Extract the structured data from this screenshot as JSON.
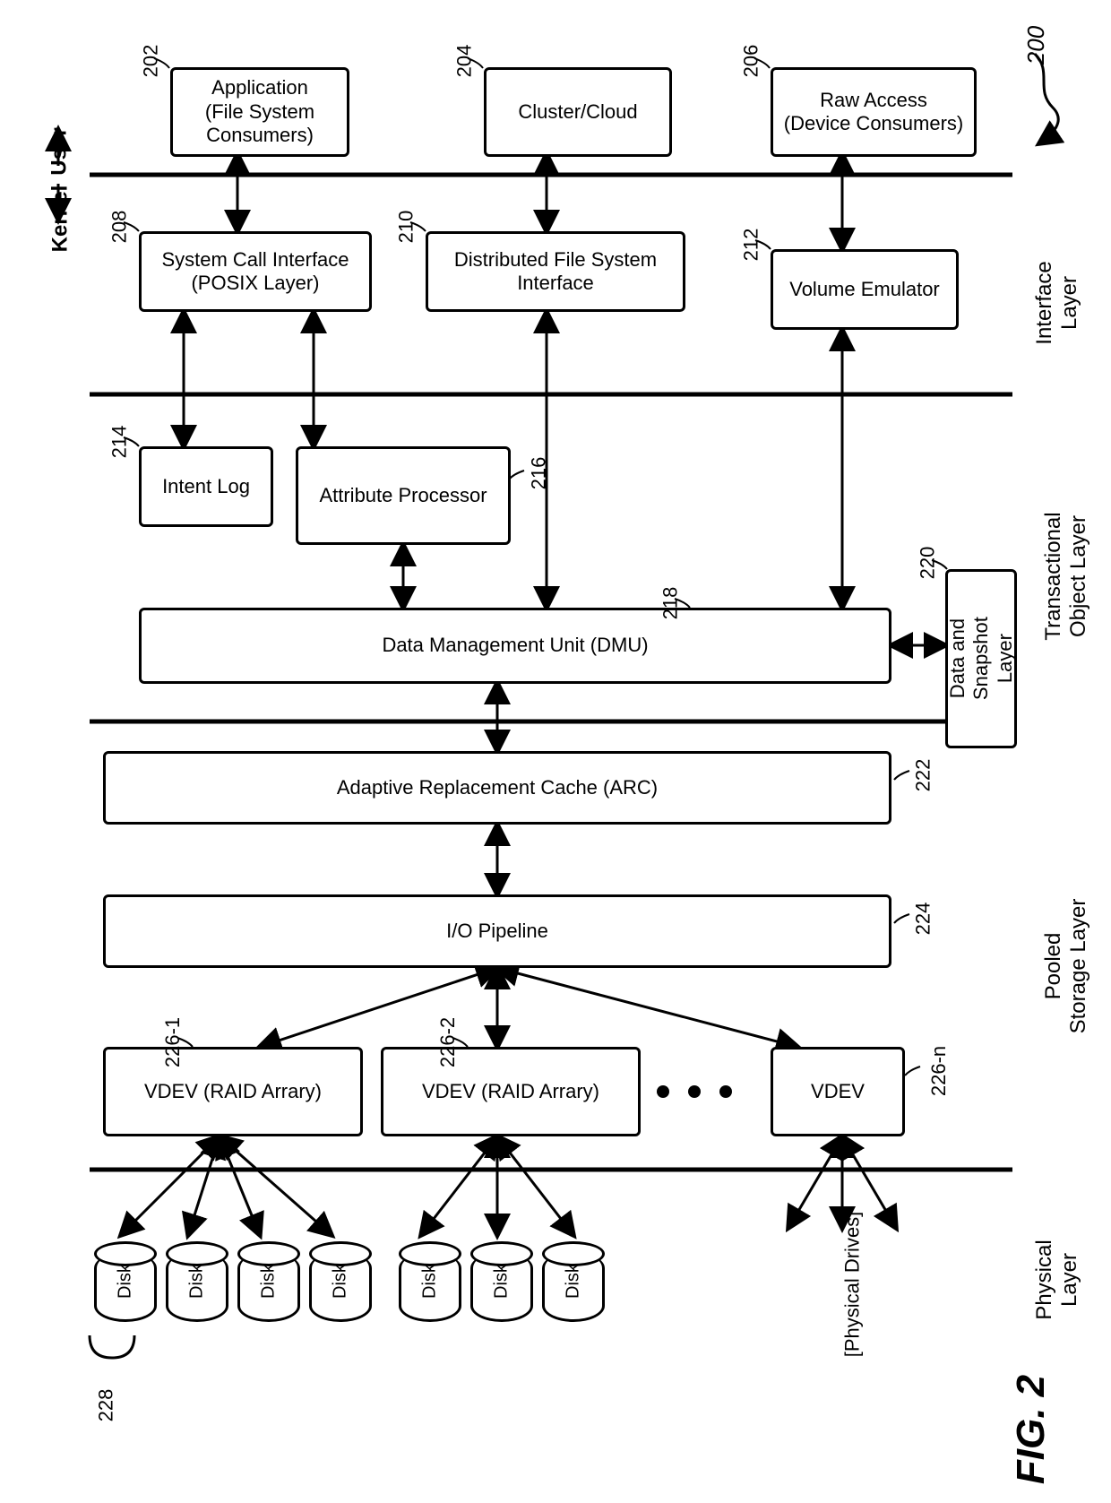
{
  "figure": {
    "title": "FIG. 2",
    "pointer": "200"
  },
  "side": {
    "user": "User",
    "kernel": "Kernel"
  },
  "layers": {
    "interface": "Interface\nLayer",
    "transactional": "Transactional\nObject Layer",
    "pooled": "Pooled\nStorage Layer",
    "physical": "Physical\nLayer"
  },
  "top": {
    "application": {
      "ref": "202",
      "label": "Application\n(File System\nConsumers)"
    },
    "cluster": {
      "ref": "204",
      "label": "Cluster/Cloud"
    },
    "raw": {
      "ref": "206",
      "label": "Raw Access\n(Device Consumers)"
    }
  },
  "interface": {
    "syscall": {
      "ref": "208",
      "label": "System Call Interface\n(POSIX Layer)"
    },
    "dfs": {
      "ref": "210",
      "label": "Distributed File System\nInterface"
    },
    "volemu": {
      "ref": "212",
      "label": "Volume Emulator"
    }
  },
  "transactional": {
    "intent": {
      "ref": "214",
      "label": "Intent Log"
    },
    "attr": {
      "ref": "216",
      "label": "Attribute Processor"
    },
    "dmu": {
      "ref": "218",
      "label": "Data Management Unit (DMU)"
    },
    "snapshot": {
      "ref": "220",
      "label": "Data and\nSnapshot Layer"
    }
  },
  "pooled": {
    "arc": {
      "ref": "222",
      "label": "Adaptive Replacement Cache (ARC)"
    },
    "io": {
      "ref": "224",
      "label": "I/O Pipeline"
    },
    "vdev1": {
      "ref": "226-1",
      "label": "VDEV (RAID Arrary)"
    },
    "vdev2": {
      "ref": "226-2",
      "label": "VDEV (RAID Arrary)"
    },
    "vdevn": {
      "ref": "226-n",
      "label": "VDEV"
    }
  },
  "physical": {
    "disk": "Disk",
    "drives": "[Physical Drives]",
    "group_ref": "228"
  }
}
